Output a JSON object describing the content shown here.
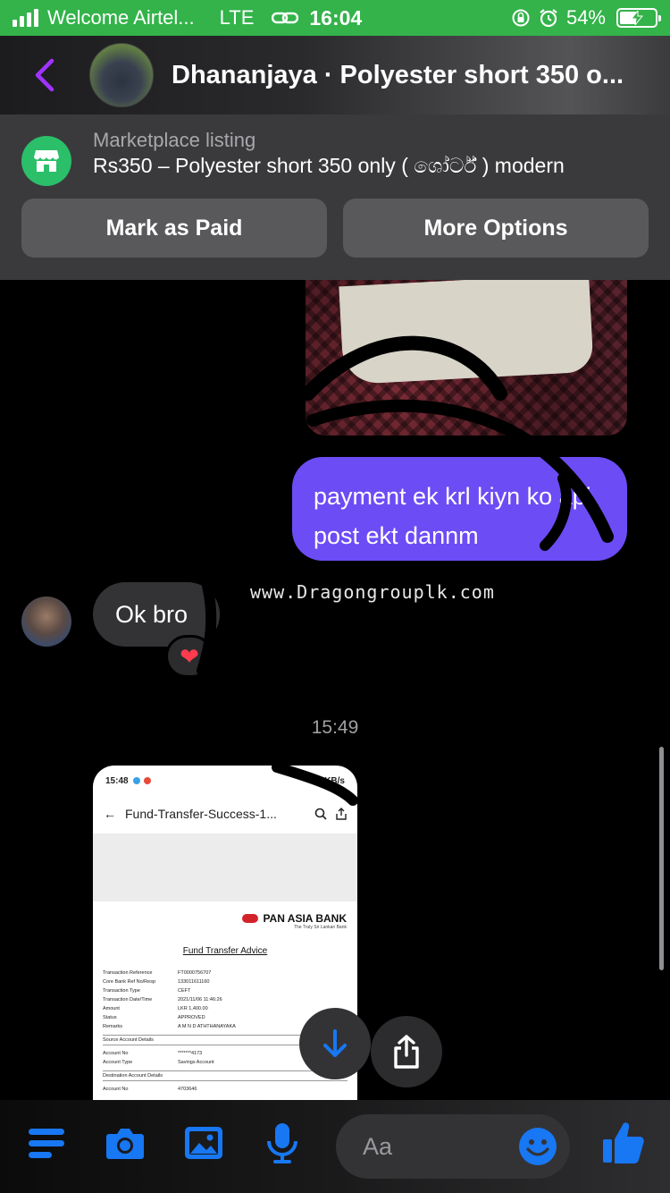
{
  "status_bar": {
    "carrier": "Welcome Airtel...",
    "network": "LTE",
    "time": "16:04",
    "battery": "54%",
    "battery_level": 0.54
  },
  "header": {
    "title": "Dhananjaya · Polyester short 350 o..."
  },
  "marketplace": {
    "label": "Marketplace listing",
    "item": "Rs350 – Polyester short 350 only ( ශෝර්ට් ) modern",
    "mark_paid": "Mark as Paid",
    "more_options": "More Options"
  },
  "messages": {
    "outgoing_text": "payment ek krl kiyn ko api post ekt dannm",
    "watermark": "www.Dragongrouplk.com",
    "incoming_text": "Ok bro",
    "reaction": "❤",
    "timestamp": "15:49"
  },
  "screenshot": {
    "time": "15:48",
    "speed": "0.4KB/s",
    "title": "Fund-Transfer-Success-1...",
    "bank": "PAN ASIA BANK",
    "tagline": "The Truly Sri Lankan Bank",
    "heading": "Fund Transfer Advice",
    "rows": [
      {
        "k": "Transaction Reference",
        "v": "FT0000756707"
      },
      {
        "k": "Core Bank Ref No/Resp",
        "v": "133011611160"
      },
      {
        "k": "Transaction Type",
        "v": "CEFT"
      },
      {
        "k": "Transaction Date/Time",
        "v": "2021/11/06 11:46:26"
      },
      {
        "k": "Amount",
        "v": "LKR 1,400.00"
      },
      {
        "k": "Status",
        "v": "APPROVED"
      },
      {
        "k": "Remarks",
        "v": "A M N D ATHTHANAYAKA"
      }
    ],
    "source_section": "Source Account Details",
    "source_rows": [
      {
        "k": "Account No",
        "v": "*******4173"
      },
      {
        "k": "Account Type",
        "v": "Savings Account"
      }
    ],
    "dest_section": "Destination Account Details",
    "dest_rows": [
      {
        "k": "Account No",
        "v": "4703646"
      }
    ]
  },
  "composer": {
    "placeholder": "Aa"
  },
  "colors": {
    "status_green": "#33b34a",
    "accent_purple": "#6c4cf5",
    "messenger_blue": "#1877f2",
    "market_green": "#2bbf6a"
  },
  "icons": [
    "signal-icon",
    "link-icon",
    "lock-rotation-icon",
    "alarm-icon",
    "battery-icon",
    "back-chevron-icon",
    "shop-icon",
    "heart-icon",
    "arrow-down-icon",
    "share-icon",
    "menu-icon",
    "camera-icon",
    "gallery-icon",
    "microphone-icon",
    "smiley-icon",
    "thumbs-up-icon"
  ]
}
